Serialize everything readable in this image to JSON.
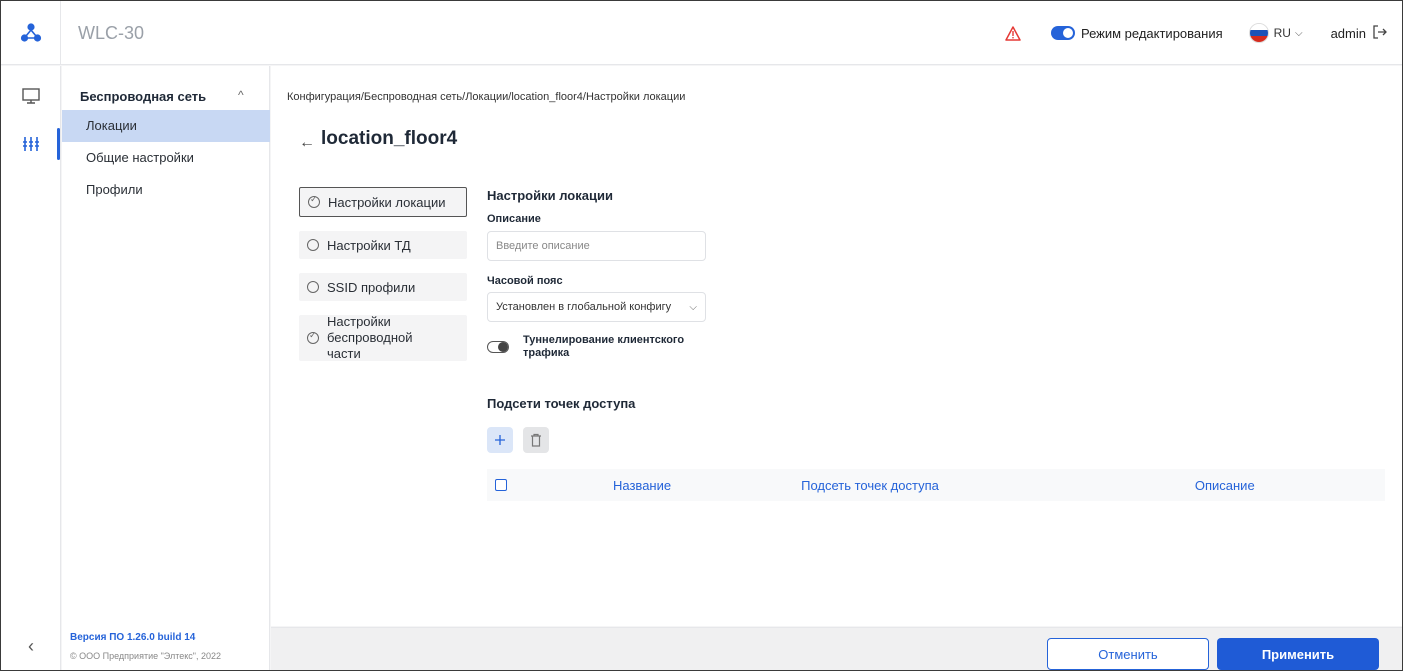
{
  "header": {
    "app_title": "WLC-30",
    "edit_mode_label": "Режим редактирования",
    "language": "RU",
    "user": "admin"
  },
  "sidebar": {
    "group_label": "Беспроводная сеть",
    "items": [
      {
        "label": "Локации",
        "active": true
      },
      {
        "label": "Общие настройки",
        "active": false
      },
      {
        "label": "Профили",
        "active": false
      }
    ],
    "version": "Версия ПО 1.26.0 build 14",
    "copyright": "© ООО Предприятие \"Элтекс\", 2022"
  },
  "main": {
    "breadcrumb": "Конфигурация/Беспроводная сеть/Локации/location_floor4/Настройки локации",
    "title": "location_floor4",
    "steps": [
      {
        "label": "Настройки локации",
        "state": "active"
      },
      {
        "label": "Настройки ТД",
        "state": "pending"
      },
      {
        "label": "SSID профили",
        "state": "pending"
      },
      {
        "label": "Настройки беспроводной части",
        "state": "done"
      }
    ],
    "form": {
      "section_title": "Настройки локации",
      "description_label": "Описание",
      "description_placeholder": "Введите описание",
      "timezone_label": "Часовой пояс",
      "timezone_value": "Установлен в глобальной конфигу",
      "tunnel_label_1": "Туннелирование клиентского",
      "tunnel_label_2": "трафика",
      "subnets_title": "Подсети точек доступа"
    },
    "table": {
      "columns": [
        "Название",
        "Подсеть точек доступа",
        "Описание"
      ],
      "rows": []
    }
  },
  "footer": {
    "cancel_label": "Отменить",
    "apply_label": "Применить"
  },
  "colors": {
    "accent": "#2563d9",
    "active_item_bg": "#c8d8f3",
    "warning": "#e53935"
  },
  "icons": [
    "logo-icon",
    "warning-icon",
    "monitor-icon",
    "config-sliders-icon",
    "chevron-up-icon",
    "back-arrow-icon",
    "plus-icon",
    "trash-icon",
    "logout-icon",
    "collapse-icon"
  ]
}
